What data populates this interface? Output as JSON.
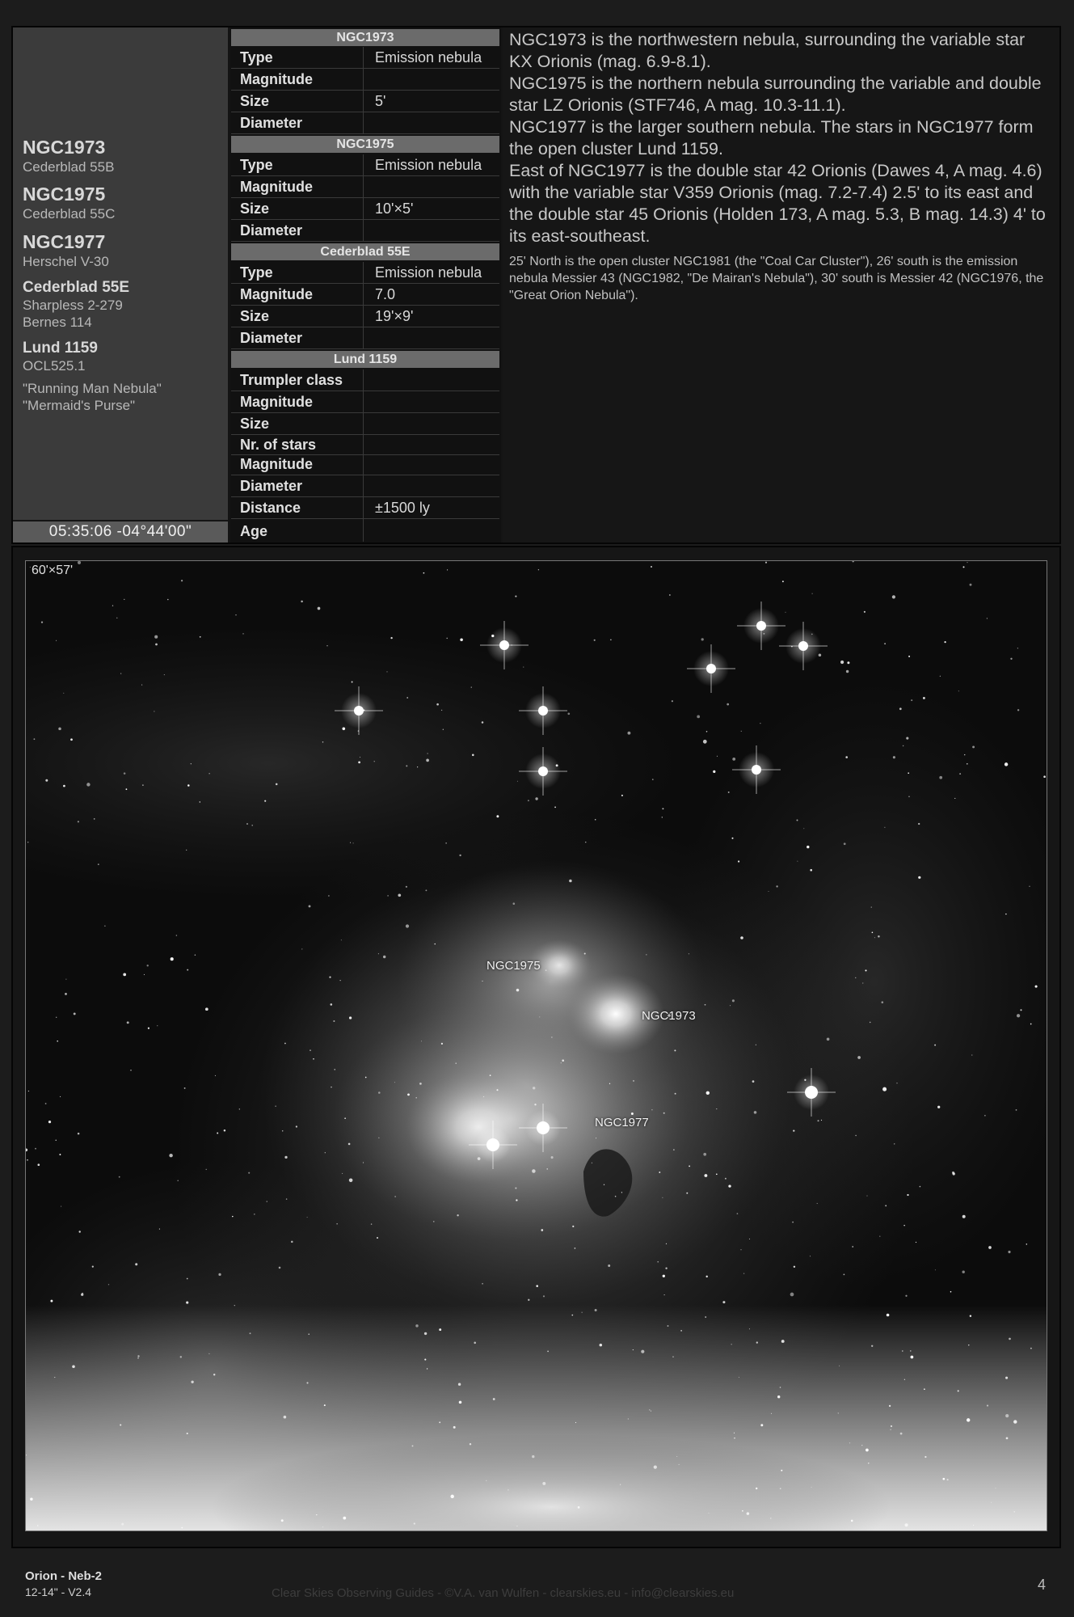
{
  "identities": [
    {
      "name": "NGC1973",
      "alias": "Cederblad 55B"
    },
    {
      "name": "NGC1975",
      "alias": "Cederblad 55C"
    },
    {
      "name": "NGC1977",
      "alias": "Herschel V-30"
    },
    {
      "name": "Cederblad 55E",
      "aliases": [
        "Sharpless 2-279",
        "Bernes 114"
      ]
    },
    {
      "name": "Lund 1159",
      "alias": "OCL525.1"
    },
    {
      "nicknames": [
        "\"Running Man Nebula\"",
        "\"Mermaid's Purse\""
      ]
    }
  ],
  "coordinates": "05:35:06 -04°44'00\"",
  "table": {
    "ngc1973": {
      "title": "NGC1973",
      "rows": [
        {
          "k": "Type",
          "v": "Emission nebula"
        },
        {
          "k": "Magnitude",
          "v": ""
        },
        {
          "k": "Size",
          "v": "5'"
        },
        {
          "k": "Diameter",
          "v": ""
        }
      ]
    },
    "ngc1975": {
      "title": "NGC1975",
      "rows": [
        {
          "k": "Type",
          "v": "Emission nebula"
        },
        {
          "k": "Magnitude",
          "v": ""
        },
        {
          "k": "Size",
          "v": "10'×5'"
        },
        {
          "k": "Diameter",
          "v": ""
        }
      ]
    },
    "ced55e": {
      "title": "Cederblad 55E",
      "rows": [
        {
          "k": "Type",
          "v": "Emission nebula"
        },
        {
          "k": "Magnitude",
          "v": "7.0"
        },
        {
          "k": "Size",
          "v": "19'×9'"
        },
        {
          "k": "Diameter",
          "v": ""
        }
      ]
    },
    "lund": {
      "title": "Lund 1159",
      "rows": [
        {
          "k": "Trumpler class",
          "v": ""
        },
        {
          "k": "Magnitude",
          "v": ""
        },
        {
          "k": "Size",
          "v": ""
        },
        {
          "k": "Nr. of stars",
          "v": ""
        },
        {
          "k": "Magnitude",
          "v": ""
        },
        {
          "k": "Diameter",
          "v": ""
        },
        {
          "k": "Distance",
          "v": "±1500 ly"
        },
        {
          "k": "Age",
          "v": ""
        }
      ]
    }
  },
  "description": {
    "p1": "NGC1973 is the northwestern nebula, surrounding the variable star KX Orionis (mag. 6.9-8.1).",
    "p2": "NGC1975 is the northern nebula surrounding the variable and double star LZ Orionis (STF746, A mag. 10.3-11.1).",
    "p3": "NGC1977 is the larger southern nebula. The stars in NGC1977 form the open cluster Lund 1159.",
    "p4": "East of NGC1977 is the double star 42 Orionis (Dawes 4, A mag. 4.6) with the variable star V359 Orionis (mag. 7.2-7.4) 2.5' to its east and the double star 45 Orionis (Holden 173, A mag. 5.3, B mag. 14.3) 4' to its east-southeast.",
    "small": "25' North is the open cluster NGC1981 (the \"Coal Car Cluster\"), 26' south is the emission nebula Messier 43 (NGC1982, \"De Mairan's Nebula\"), 30' south is Messier 42 (NGC1976, the \"Great Orion Nebula\")."
  },
  "photo": {
    "fov": "60'×57'",
    "labels": {
      "ngc1975": "NGC1975",
      "ngc1973": "NGC1973",
      "ngc1977": "NGC1977"
    }
  },
  "footer": {
    "title": "Orion - Neb-2",
    "scope": "12-14\" - V2.4",
    "credit": "Clear Skies Observing Guides - ©V.A. van Wulfen - clearskies.eu - info@clearskies.eu",
    "page": "4"
  }
}
